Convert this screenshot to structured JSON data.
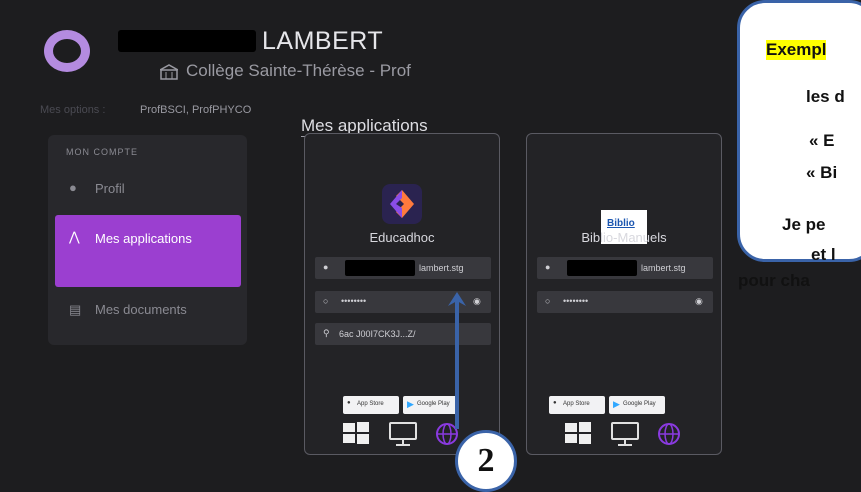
{
  "header": {
    "user_name": "LAMBERT",
    "school": "Collège Sainte-Thérèse - Prof",
    "profiles_label": "Mes options :",
    "profiles": "ProfBSCI, ProfPHYCO"
  },
  "sidebar": {
    "heading": "MON COMPTE",
    "items": [
      {
        "label": "Profil",
        "icon": "user-icon"
      },
      {
        "label": "Mes applications",
        "icon": "apps-icon",
        "active": true
      },
      {
        "label": "Mes documents",
        "icon": "documents-icon"
      }
    ]
  },
  "main": {
    "title": "Mes applications",
    "cards": [
      {
        "name": "Educadhoc",
        "login": "lambert.stg",
        "password": "••••••••",
        "code": "6ac J00I7CK3J...Z/",
        "logo_text": ""
      },
      {
        "name": "Biblio-Manuels",
        "login": "lambert.stg",
        "password": "••••••••",
        "logo_text": "Biblio"
      }
    ],
    "store_buttons": [
      "App Store",
      "Google Play"
    ]
  },
  "callout": {
    "lines": [
      "Exempl",
      "les d",
      "«  E",
      "« Bi",
      "Je pe",
      "et l",
      "pour cha"
    ]
  },
  "annotation": {
    "number": "2"
  },
  "colors": {
    "accent": "#9b3fd0",
    "callout_border": "#3a63a8",
    "highlight": "#ffff00"
  }
}
